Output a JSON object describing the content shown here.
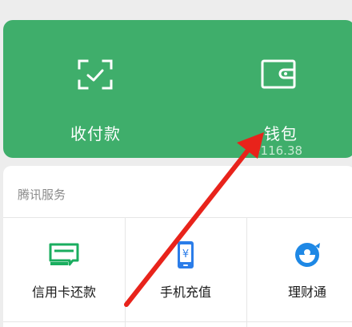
{
  "wallet_panel": {
    "pay_label": "收付款",
    "wallet_label": "钱包",
    "wallet_amount": "¥116.38"
  },
  "services": {
    "title": "腾讯服务",
    "items": [
      {
        "label": "信用卡还款",
        "icon": "credit-card-icon"
      },
      {
        "label": "手机充值",
        "icon": "phone-topup-icon"
      },
      {
        "label": "理财通",
        "icon": "wealth-icon"
      }
    ]
  },
  "colors": {
    "panel_green": "#3fae6b",
    "service_green": "#1aad5f",
    "phone_blue": "#2b7de9",
    "wealth_blue": "#1e88e5",
    "annotation_red": "#e8231b"
  }
}
